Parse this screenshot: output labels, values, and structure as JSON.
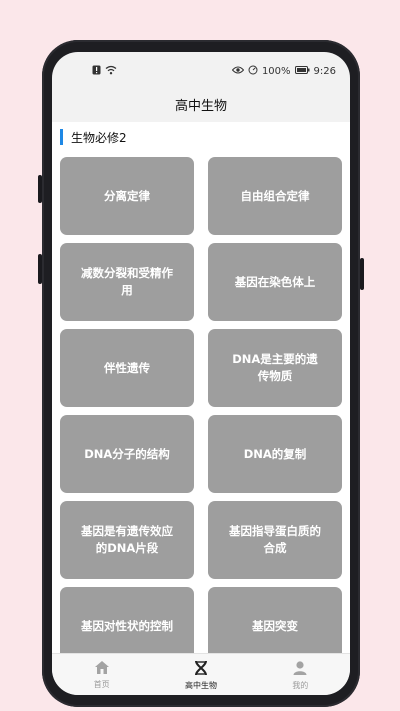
{
  "status_bar": {
    "battery": "100%",
    "time": "9:26"
  },
  "app_bar": {
    "title": "高中生物"
  },
  "section": {
    "title": "生物必修2"
  },
  "cards": [
    "分离定律",
    "自由组合定律",
    "减数分裂和受精作用",
    "基因在染色体上",
    "伴性遗传",
    "DNA是主要的遗传物质",
    "DNA分子的结构",
    "DNA的复制",
    "基因是有遗传效应的DNA片段",
    "基因指导蛋白质的合成",
    "基因对性状的控制",
    "基因突变"
  ],
  "tabs": [
    {
      "label": "首页",
      "icon": "home-icon",
      "active": false
    },
    {
      "label": "高中生物",
      "icon": "dna-icon",
      "active": true
    },
    {
      "label": "我的",
      "icon": "person-icon",
      "active": false
    }
  ],
  "colors": {
    "accent": "#1e88e5",
    "card": "#9e9e9e",
    "background": "#fbe7ea"
  }
}
